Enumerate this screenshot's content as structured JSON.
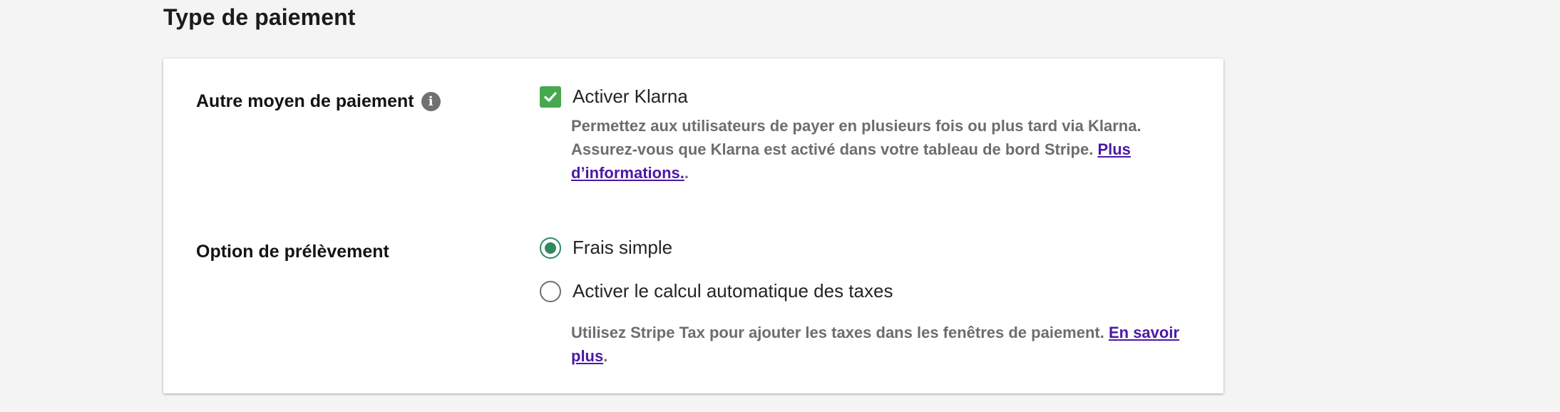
{
  "section": {
    "title": "Type de paiement"
  },
  "alt_payment": {
    "label": "Autre moyen de paiement",
    "info_icon": "info-icon",
    "checkbox_label": "Activer Klarna",
    "checked": true,
    "help_text": "Permettez aux utilisateurs de payer en plusieurs fois ou plus tard via Klarna. Assurez-vous que Klarna est activé dans votre tableau de bord Stripe. ",
    "help_link": "Plus d’informations.",
    "help_suffix": "."
  },
  "charge_option": {
    "label": "Option de prélèvement",
    "options": [
      {
        "label": "Frais simple",
        "selected": true
      },
      {
        "label": "Activer le calcul automatique des taxes",
        "selected": false
      }
    ],
    "help_text": "Utilisez Stripe Tax pour ajouter les taxes dans les fenêtres de paiement. ",
    "help_link": "En savoir plus",
    "help_suffix": "."
  },
  "colors": {
    "accent_green": "#46a94e",
    "radio_green": "#2f8a5e",
    "link_purple": "#4a1aa5"
  }
}
